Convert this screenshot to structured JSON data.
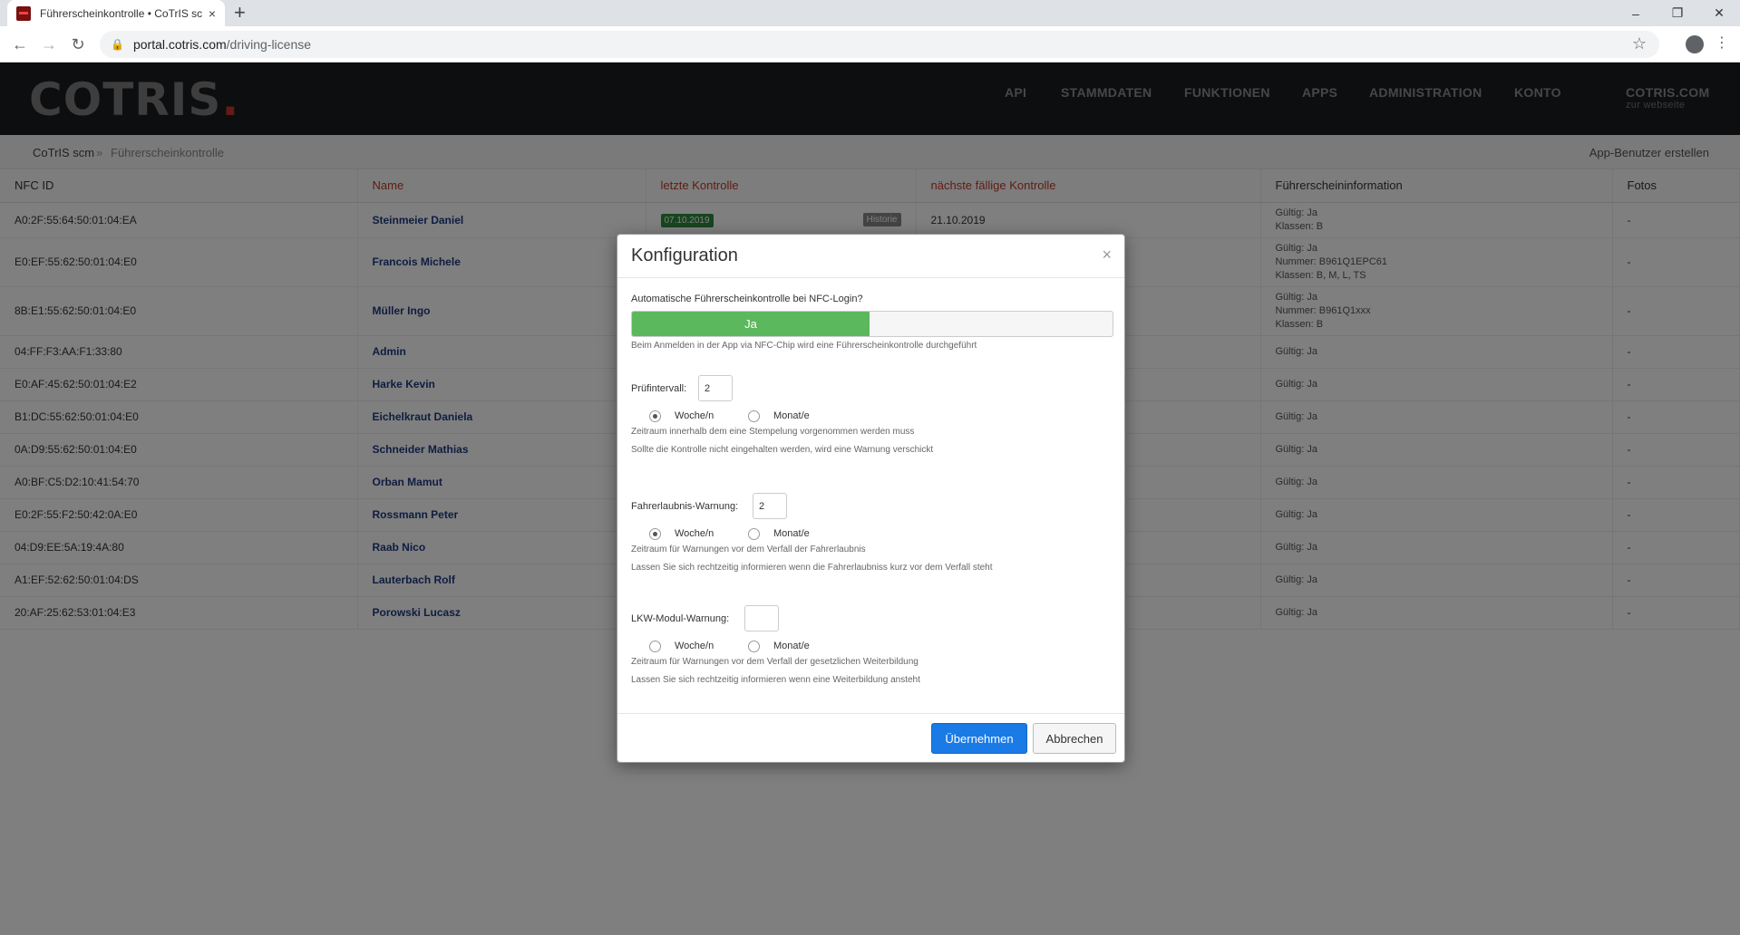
{
  "browser": {
    "tab_title": "Führerscheinkontrolle • CoTrIS sc",
    "tab_close": "×",
    "new_tab": "+",
    "url_host": "portal.cotris.com",
    "url_path": "/driving-license"
  },
  "site": {
    "logo_text": "COTRIS",
    "logo_dot": ".",
    "nav": [
      "API",
      "STAMMDATEN",
      "FUNKTIONEN",
      "APPS",
      "ADMINISTRATION",
      "KONTO"
    ],
    "nav_external": "COTRIS.COM",
    "nav_external_sub": "zur webseite"
  },
  "breadcrumb": {
    "items": [
      "CoTrIS scm",
      "Führerscheinkontrolle"
    ],
    "separator": "»"
  },
  "actions": {
    "create_app_user": "App-Benutzer erstellen"
  },
  "table": {
    "headers": [
      "NFC ID",
      "Name",
      "letzte Kontrolle",
      "nächste fällige Kontrolle",
      "Führerscheininformation",
      "Fotos"
    ],
    "rows": [
      {
        "nfc": "A0:2F:55:64:50:01:04:EA",
        "name": "Steinmeier Daniel",
        "last": "07.10.2019",
        "hist": "Historie",
        "next": "21.10.2019",
        "info": [
          "Gültig: Ja",
          "Klassen: B"
        ],
        "photos": "-"
      },
      {
        "nfc": "E0:EF:55:62:50:01:04:E0",
        "name": "Francois Michele",
        "last": "",
        "hist": "",
        "next": "",
        "info": [
          "Gültig: Ja",
          "Nummer: B961Q1EPC61",
          "Klassen: B, M, L, TS"
        ],
        "photos": "-"
      },
      {
        "nfc": "8B:E1:55:62:50:01:04:E0",
        "name": "Müller Ingo",
        "last": "",
        "hist": "",
        "next": "",
        "info": [
          "Gültig: Ja",
          "Nummer: B961Q1xxx",
          "Klassen: B"
        ],
        "photos": "-"
      },
      {
        "nfc": "04:FF:F3:AA:F1:33:80",
        "name": "Admin",
        "last": "",
        "hist": "",
        "next": "",
        "info": [
          "Gültig: Ja"
        ],
        "photos": "-"
      },
      {
        "nfc": "E0:AF:45:62:50:01:04:E2",
        "name": "Harke Kevin",
        "last": "",
        "hist": "",
        "next": "",
        "info": [
          "Gültig: Ja"
        ],
        "photos": "-"
      },
      {
        "nfc": "B1:DC:55:62:50:01:04:E0",
        "name": "Eichelkraut Daniela",
        "last": "",
        "hist": "",
        "next": "",
        "info": [
          "Gültig: Ja"
        ],
        "photos": "-"
      },
      {
        "nfc": "0A:D9:55:62:50:01:04:E0",
        "name": "Schneider Mathias",
        "last": "",
        "hist": "",
        "next": "",
        "info": [
          "Gültig: Ja"
        ],
        "photos": "-"
      },
      {
        "nfc": "A0:BF:C5:D2:10:41:54:70",
        "name": "Orban Mamut",
        "last": "",
        "hist": "",
        "next": "",
        "info": [
          "Gültig: Ja"
        ],
        "photos": "-"
      },
      {
        "nfc": "E0:2F:55:F2:50:42:0A:E0",
        "name": "Rossmann Peter",
        "last": "",
        "hist": "",
        "next": "",
        "info": [
          "Gültig: Ja"
        ],
        "photos": "-"
      },
      {
        "nfc": "04:D9:EE:5A:19:4A:80",
        "name": "Raab Nico",
        "last": "",
        "hist": "",
        "next": "",
        "info": [
          "Gültig: Ja"
        ],
        "photos": "-"
      },
      {
        "nfc": "A1:EF:52:62:50:01:04:DS",
        "name": "Lauterbach Rolf",
        "last": "",
        "hist": "",
        "next": "",
        "info": [
          "Gültig: Ja"
        ],
        "photos": "-"
      },
      {
        "nfc": "20:AF:25:62:53:01:04:E3",
        "name": "Porowski Lucasz",
        "last": "",
        "hist": "",
        "next": "",
        "info": [
          "Gültig: Ja"
        ],
        "photos": "-"
      }
    ]
  },
  "modal": {
    "title": "Konfiguration",
    "close": "×",
    "auto_check_label": "Automatische Führerscheinkontrolle bei NFC-Login?",
    "auto_check_value": "Ja",
    "auto_check_help": "Beim Anmelden in der App via NFC-Chip wird eine Führerscheinkontrolle durchgeführt",
    "interval_label": "Prüfintervall:",
    "interval_value": "2",
    "interval_help_1": "Zeitraum innerhalb dem eine Stempelung vorgenommen werden muss",
    "interval_help_2": "Sollte die Kontrolle nicht eingehalten werden, wird eine Warnung verschickt",
    "license_warning_label": "Fahrerlaubnis-Warnung:",
    "license_warning_value": "2",
    "license_warning_help_1": "Zeitraum für Warnungen vor dem Verfall der Fahrerlaubnis",
    "license_warning_help_2": "Lassen Sie sich rechtzeitig informieren wenn die Fahrerlaubniss kurz vor dem Verfall steht",
    "truck_warning_label": "LKW-Modul-Warnung:",
    "truck_warning_value": "",
    "truck_warning_help_1": "Zeitraum für Warnungen vor dem Verfall der gesetzlichen Weiterbildung",
    "truck_warning_help_2": "Lassen Sie sich rechtzeitig informieren wenn eine Weiterbildung ansteht",
    "unit_weeks": "Woche/n",
    "unit_months": "Monat/e",
    "apply": "Übernehmen",
    "cancel": "Abbrechen"
  }
}
